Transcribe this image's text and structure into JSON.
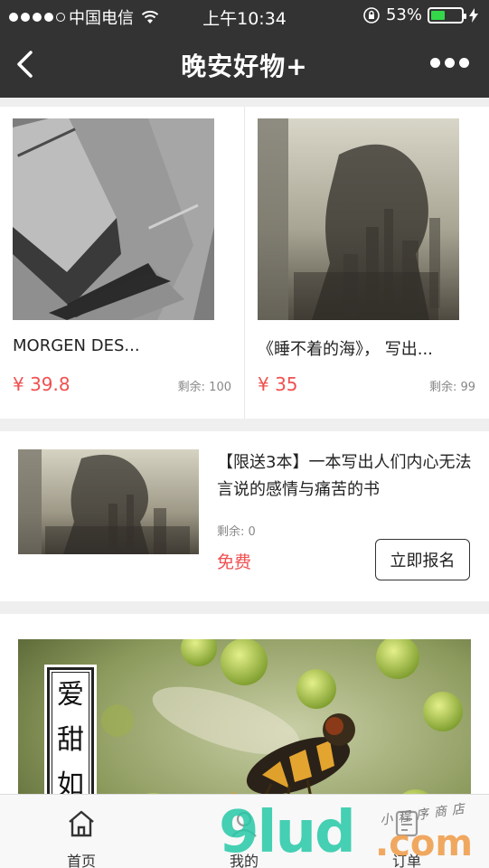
{
  "status_bar": {
    "carrier": "中国电信",
    "time": "上午10:34",
    "battery_percent": "53%",
    "battery_level": 0.53,
    "icons": [
      "signal-dots-icon",
      "wifi-icon",
      "orientation-lock-icon",
      "battery-icon",
      "charging-bolt-icon"
    ]
  },
  "nav": {
    "title": "晚安好物+",
    "back_icon": "chevron-left-icon",
    "more_icon": "more-dots-icon"
  },
  "products": [
    {
      "title": "MORGEN DES...",
      "price": "¥ 39.8",
      "stock": "剩余: 100",
      "image": "notebooks-photo"
    },
    {
      "title": "《睡不着的海》， 写出...",
      "price": "¥ 35",
      "stock": "剩余: 99",
      "image": "city-silhouette-photo"
    }
  ],
  "promo": {
    "title": "【限送3本】一本写出人们内心无法言说的感情与痛苦的书",
    "stock": "剩余: 0",
    "price": "免费",
    "button_label": "立即报名",
    "image": "city-silhouette-photo"
  },
  "banner": {
    "tag_chars": [
      "爱",
      "甜",
      "如"
    ],
    "image": "hoverfly-on-flowers-photo"
  },
  "tabbar": {
    "tabs": [
      {
        "label": "首页",
        "icon": "home-icon"
      },
      {
        "label": "我的",
        "icon": "user-icon"
      },
      {
        "label": "订单",
        "icon": "order-icon"
      }
    ]
  },
  "watermark": {
    "text": "9lud",
    "suffix": ".com",
    "subtext": "小程序商店"
  },
  "colors": {
    "header_bg": "#333333",
    "price_red": "#f05050",
    "battery_green": "#34d74a",
    "watermark_green": "#26c9a8"
  }
}
